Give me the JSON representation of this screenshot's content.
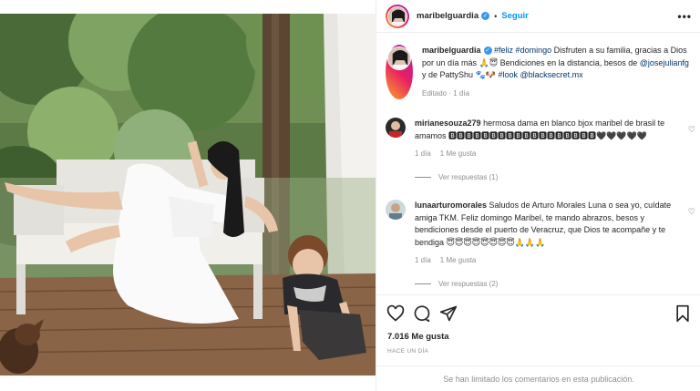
{
  "header": {
    "username": "maribelguardia",
    "verified_mark": "✓",
    "separator": "•",
    "follow_label": "Seguir",
    "more_label": "•••"
  },
  "caption": {
    "username": "maribelguardia",
    "tags": "#feliz #domingo",
    "text1": " Disfruten a su familia, gracias a Dios por un día más 🙏😇 Bendiciones en la distancia, besos de ",
    "mention1": "@josejulianfg",
    "text2": " y de PattyShu 🐾🐶 ",
    "tag2": "#look",
    "mention2": "@blacksecret.mx",
    "meta": "Editado · 1 día"
  },
  "comments": [
    {
      "username": "mirianesouza279",
      "text": "hermosa dama en blanco bjox maribel de brasil te amamos 🅱🅱🅱🅱🅱🅱🅱🅱🅱🅱🅱🅱🅱🅱🅱🅱🅱🅱🖤🖤🖤🖤🖤",
      "age": "1 día",
      "likes": "1 Me gusta",
      "replies": "Ver respuestas (1)"
    },
    {
      "username": "lunaarturomorales",
      "text": "Saludos de Arturo Morales Luna o sea yo, cuídate amiga TKM. Feliz domingo Maribel, te mando abrazos, besos y bendiciones desde el puerto de Veracruz, que Dios te acompañe y te bendiga 😇😇😇😇😇😇😇😇🙏🙏🙏",
      "age": "1 día",
      "likes": "1 Me gusta",
      "replies": "Ver respuestas (2)"
    }
  ],
  "icons": {
    "heart": "heart-icon",
    "comment": "comment-icon",
    "share": "share-icon",
    "save": "bookmark-icon"
  },
  "likes_count": "7.016 Me gusta",
  "posted_time": "HACE UN DÍA",
  "comments_limited": "Se han limitado los comentarios en esta publicación.",
  "colors": {
    "link": "#00376b",
    "follow": "#0095f6",
    "muted": "#8e8e8e",
    "verified": "#3897f0"
  }
}
